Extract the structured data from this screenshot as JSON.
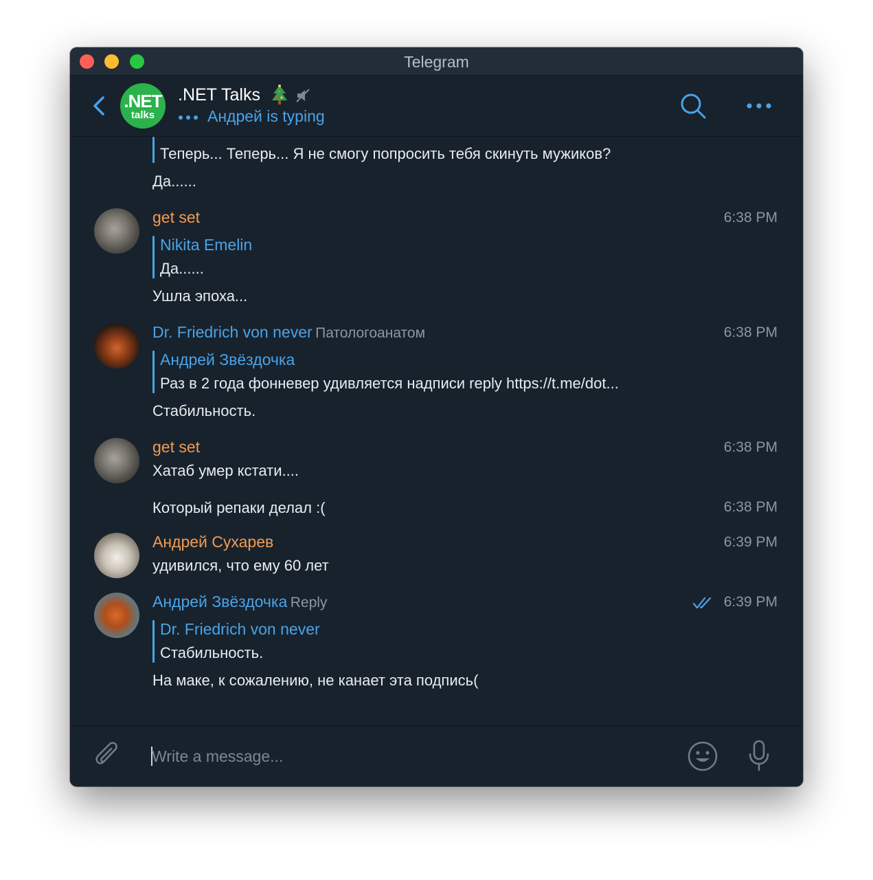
{
  "window": {
    "title": "Telegram"
  },
  "header": {
    "avatar_big": ".NET",
    "avatar_small": "talks",
    "chat_title": ".NET Talks",
    "typing_status": "Андрей is typing"
  },
  "messages": [
    {
      "reply_text": "Теперь... Теперь... Я не смогу попросить тебя скинуть мужиков?",
      "text": "Да......"
    },
    {
      "author": "get set",
      "time": "6:38 PM",
      "reply_author": "Nikita Emelin",
      "reply_text": "Да......",
      "text": "Ушла эпоха..."
    },
    {
      "author": "Dr. Friedrich von never",
      "badge": "Патологоанатом",
      "time": "6:38 PM",
      "reply_author": "Андрей Звёздочка",
      "reply_text": "Раз в 2 года фонневер удивляется надписи reply https://t.me/dot...",
      "text": "Стабильность."
    },
    {
      "author": "get set",
      "time": "6:38 PM",
      "text": "Хатаб умер кстати...."
    },
    {
      "time": "6:38 PM",
      "text": "Который репаки делал :("
    },
    {
      "author": "Андрей Сухарев",
      "time": "6:39 PM",
      "text": "удивился, что ему 60 лет"
    },
    {
      "author": "Андрей Звёздочка",
      "badge": "Reply",
      "time": "6:39 PM",
      "reply_author": "Dr. Friedrich von never",
      "reply_text": "Стабильность.",
      "text": "На маке, к сожалению, не канает эта подпись("
    }
  ],
  "composer": {
    "placeholder": "Write a message..."
  },
  "colors": {
    "background": "#18222d",
    "accent": "#4aa3e8",
    "author_orange": "#f29b4f",
    "group_avatar": "#2bb24c"
  }
}
